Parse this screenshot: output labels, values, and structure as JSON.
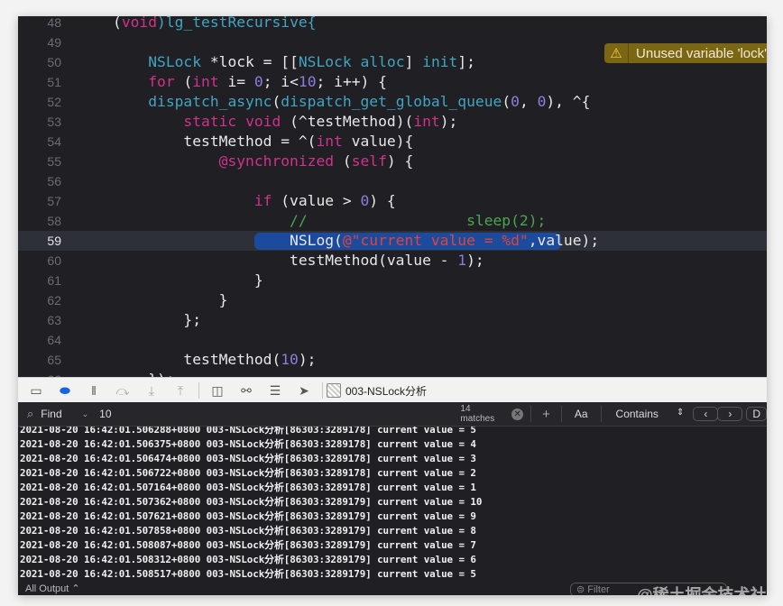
{
  "editor": {
    "lines": [
      {
        "n": "48",
        "tokens": [
          [
            "(",
            "pl"
          ],
          [
            "void",
            "kw"
          ],
          [
            ")lg_testRecursive{",
            "ty"
          ]
        ]
      },
      {
        "n": "49",
        "tokens": []
      },
      {
        "n": "50",
        "tokens": [
          [
            "    ",
            "pl"
          ],
          [
            "NSLock",
            "ty"
          ],
          [
            " *lock = [[",
            "pl"
          ],
          [
            "NSLock",
            "ty"
          ],
          [
            " ",
            "pl"
          ],
          [
            "alloc",
            "ty"
          ],
          [
            "] ",
            "pl"
          ],
          [
            "init",
            "ty"
          ],
          [
            "];",
            "pl"
          ]
        ]
      },
      {
        "n": "51",
        "tokens": [
          [
            "    ",
            "pl"
          ],
          [
            "for",
            "kw"
          ],
          [
            " (",
            "pl"
          ],
          [
            "int",
            "kw"
          ],
          [
            " i= ",
            "pl"
          ],
          [
            "0",
            "nu"
          ],
          [
            "; i<",
            "pl"
          ],
          [
            "10",
            "nu"
          ],
          [
            "; i++) {",
            "pl"
          ]
        ]
      },
      {
        "n": "52",
        "tokens": [
          [
            "    ",
            "pl"
          ],
          [
            "dispatch_async",
            "ty"
          ],
          [
            "(",
            "pl"
          ],
          [
            "dispatch_get_global_queue",
            "ty"
          ],
          [
            "(",
            "pl"
          ],
          [
            "0",
            "nu"
          ],
          [
            ", ",
            "pl"
          ],
          [
            "0",
            "nu"
          ],
          [
            "), ^{",
            "pl"
          ]
        ]
      },
      {
        "n": "53",
        "tokens": [
          [
            "        ",
            "pl"
          ],
          [
            "static",
            "kw"
          ],
          [
            " ",
            "pl"
          ],
          [
            "void",
            "kw"
          ],
          [
            " (^testMethod)(",
            "pl"
          ],
          [
            "int",
            "kw"
          ],
          [
            ");",
            "pl"
          ]
        ]
      },
      {
        "n": "54",
        "tokens": [
          [
            "        testMethod = ^(",
            "pl"
          ],
          [
            "int",
            "kw"
          ],
          [
            " value){",
            "pl"
          ]
        ]
      },
      {
        "n": "55",
        "tokens": [
          [
            "            ",
            "pl"
          ],
          [
            "@synchronized",
            "kw"
          ],
          [
            " (",
            "pl"
          ],
          [
            "self",
            "kw"
          ],
          [
            ") {",
            "pl"
          ]
        ]
      },
      {
        "n": "56",
        "tokens": []
      },
      {
        "n": "57",
        "tokens": [
          [
            "                ",
            "pl"
          ],
          [
            "if",
            "kw"
          ],
          [
            " (value > ",
            "pl"
          ],
          [
            "0",
            "nu"
          ],
          [
            ") {",
            "pl"
          ]
        ]
      },
      {
        "n": "58",
        "tokens": [
          [
            "                    ",
            "pl"
          ],
          [
            "//                  sleep(2);",
            "cm"
          ]
        ]
      },
      {
        "n": "59",
        "tokens": [
          [
            "                    NSLog(",
            "pl"
          ],
          [
            "@\"current value = %d\"",
            "st"
          ],
          [
            ",value);",
            "pl"
          ]
        ],
        "current": true
      },
      {
        "n": "60",
        "tokens": [
          [
            "                    testMethod(value - ",
            "pl"
          ],
          [
            "1",
            "nu"
          ],
          [
            ");",
            "pl"
          ]
        ]
      },
      {
        "n": "61",
        "tokens": [
          [
            "                }",
            "pl"
          ]
        ]
      },
      {
        "n": "62",
        "tokens": [
          [
            "            }",
            "pl"
          ]
        ]
      },
      {
        "n": "63",
        "tokens": [
          [
            "        };",
            "pl"
          ]
        ]
      },
      {
        "n": "64",
        "tokens": []
      },
      {
        "n": "65",
        "tokens": [
          [
            "        testMethod(",
            "pl"
          ],
          [
            "10",
            "nu"
          ],
          [
            ");",
            "pl"
          ]
        ]
      },
      {
        "n": "66",
        "tokens": [
          [
            "    });",
            "pl"
          ]
        ]
      }
    ],
    "warning": "Unused variable 'lock'"
  },
  "toolbar": {
    "target": "003-NSLock分析"
  },
  "find": {
    "label": "Find",
    "query": "10",
    "matches": "14 matches",
    "case": "Aa",
    "mode": "Contains"
  },
  "console": {
    "lines": [
      "2021-08-20 16:42:01.506288+0800 003-NSLock分析[86303:3289178] current value = 5",
      "2021-08-20 16:42:01.506375+0800 003-NSLock分析[86303:3289178] current value = 4",
      "2021-08-20 16:42:01.506474+0800 003-NSLock分析[86303:3289178] current value = 3",
      "2021-08-20 16:42:01.506722+0800 003-NSLock分析[86303:3289178] current value = 2",
      "2021-08-20 16:42:01.507164+0800 003-NSLock分析[86303:3289178] current value = 1",
      "2021-08-20 16:42:01.507362+0800 003-NSLock分析[86303:3289179] current value = 10",
      "2021-08-20 16:42:01.507621+0800 003-NSLock分析[86303:3289179] current value = 9",
      "2021-08-20 16:42:01.507858+0800 003-NSLock分析[86303:3289179] current value = 8",
      "2021-08-20 16:42:01.508087+0800 003-NSLock分析[86303:3289179] current value = 7",
      "2021-08-20 16:42:01.508312+0800 003-NSLock分析[86303:3289179] current value = 6",
      "2021-08-20 16:42:01.508517+0800 003-NSLock分析[86303:3289179] current value = 5"
    ],
    "output_selector": "All Output ⌃",
    "filter_placeholder": "Filter"
  },
  "watermark": "@稀土掘金技术社区"
}
